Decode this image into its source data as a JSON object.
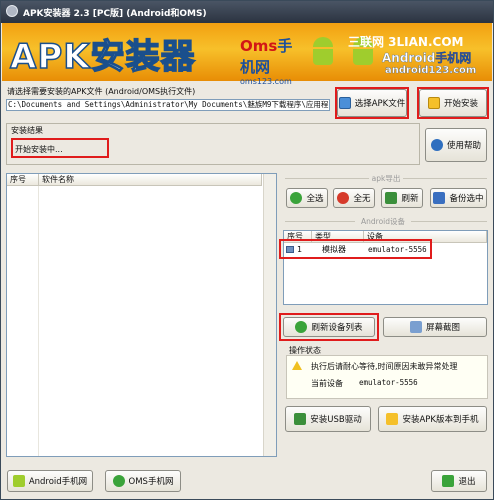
{
  "window": {
    "title": "APK安装器 2.3 [PC版]  (Android和OMS)"
  },
  "banner": {
    "app_name": "APK安装器",
    "oms_logo_a": "Oms",
    "oms_logo_b": "手机网",
    "oms_url": "oms123.com",
    "site": "三联网 3LIAN.COM",
    "android_logo_a": "Android",
    "android_logo_b": "手机网",
    "android_url": "android123.com"
  },
  "file": {
    "prompt": "请选择需要安装的APK文件  (Android/OMS执行文件)",
    "path": "C:\\Documents and Settings\\Administrator\\My Documents\\魅族M9下载程序\\应用程"
  },
  "buttons": {
    "choose_apk": "选择APK文件",
    "start_install": "开始安装",
    "help": "使用帮助",
    "select_all": "全选",
    "select_none": "全无",
    "refresh": "刷新",
    "backup": "备份选中",
    "refresh_devices": "刷新设备列表",
    "screenshot": "屏幕截图",
    "install_usb": "安装USB驱动",
    "install_apk_version": "安装APK版本到手机",
    "android_site": "Android手机网",
    "oms_site": "OMS手机网",
    "exit": "退出"
  },
  "result": {
    "label": "安装结果",
    "text": "开始安装中..."
  },
  "apk_list": {
    "columns": [
      "序号",
      "软件名称"
    ],
    "rows": []
  },
  "apk_export": {
    "label": "apk导出"
  },
  "devices": {
    "label": "Android设备",
    "columns": [
      "序号",
      "类型",
      "设备"
    ],
    "rows": [
      {
        "index": "1",
        "type": "模拟器",
        "device": "emulator-5556"
      }
    ]
  },
  "status": {
    "label": "操作状态",
    "message": "执行后请耐心等待,时间原因未敢异常处理",
    "device_label": "当前设备",
    "device_value": "emulator-5556"
  }
}
